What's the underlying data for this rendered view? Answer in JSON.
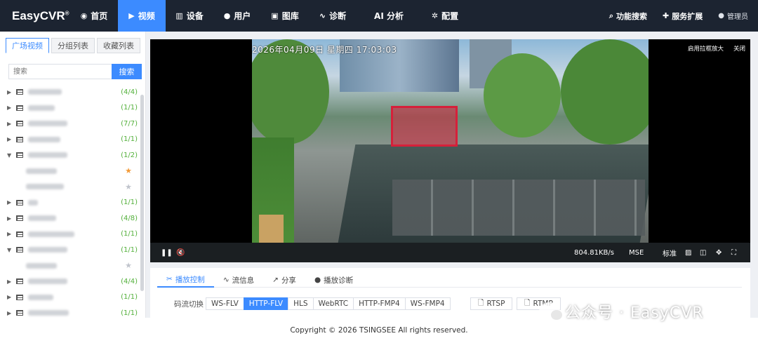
{
  "app": {
    "logo": "EasyCVR",
    "logo_mark": "®"
  },
  "nav": [
    {
      "label": "首页",
      "icon": "dashboard-icon"
    },
    {
      "label": "视频",
      "icon": "play-circle-icon",
      "active": true
    },
    {
      "label": "设备",
      "icon": "device-icon"
    },
    {
      "label": "用户",
      "icon": "user-icon"
    },
    {
      "label": "图库",
      "icon": "gallery-icon"
    },
    {
      "label": "诊断",
      "icon": "pulse-icon"
    },
    {
      "label": "AI 分析",
      "icon": ""
    },
    {
      "label": "配置",
      "icon": "gear-icon"
    }
  ],
  "right_nav": {
    "search": "功能搜索",
    "extend": "服务扩展",
    "user": "管理员"
  },
  "sidebar": {
    "tabs": [
      "广场视频",
      "分组列表",
      "收藏列表"
    ],
    "search_placeholder": "搜索",
    "search_button": "搜索",
    "tree": [
      {
        "count": "(4/4)",
        "expanded": false
      },
      {
        "count": "(1/1)",
        "expanded": false
      },
      {
        "count": "(7/7)",
        "expanded": false
      },
      {
        "count": "(1/1)",
        "expanded": false
      },
      {
        "count": "(1/2)",
        "expanded": true,
        "children": [
          {
            "starred": true
          },
          {
            "starred": false
          }
        ]
      },
      {
        "count": "(1/1)",
        "expanded": false
      },
      {
        "count": "(4/8)",
        "expanded": false
      },
      {
        "count": "(1/1)",
        "expanded": false
      },
      {
        "count": "(1/1)",
        "expanded": true,
        "children": [
          {
            "starred": false
          }
        ]
      },
      {
        "count": "(4/4)",
        "expanded": false
      },
      {
        "count": "(1/1)",
        "expanded": false
      },
      {
        "count": "(1/1)",
        "expanded": false
      }
    ]
  },
  "video": {
    "timestamp": "2026年04月09日 星期四 17:03:03",
    "enable_zoom": "启用拉框放大",
    "close": "关闭",
    "speed": "804.81KB/s",
    "mode": "MSE",
    "quality": "标准"
  },
  "panel": {
    "tabs": [
      "播放控制",
      "流信息",
      "分享",
      "播放诊断"
    ],
    "stream_label": "码流切换",
    "streams": [
      "WS-FLV",
      "HTTP-FLV",
      "HLS",
      "WebRTC",
      "HTTP-FMP4",
      "WS-FMP4"
    ],
    "active_stream": "HTTP-FLV",
    "protocols": [
      "RTSP",
      "RTMP"
    ]
  },
  "footer": "Copyright © 2026 TSINGSEE All rights reserved.",
  "watermark": "公众号 · EasyCVR",
  "colors": {
    "accent": "#3c8bff",
    "nav_bg": "#1c2431",
    "count_green": "#52b03a",
    "star_orange": "#f29a38"
  }
}
